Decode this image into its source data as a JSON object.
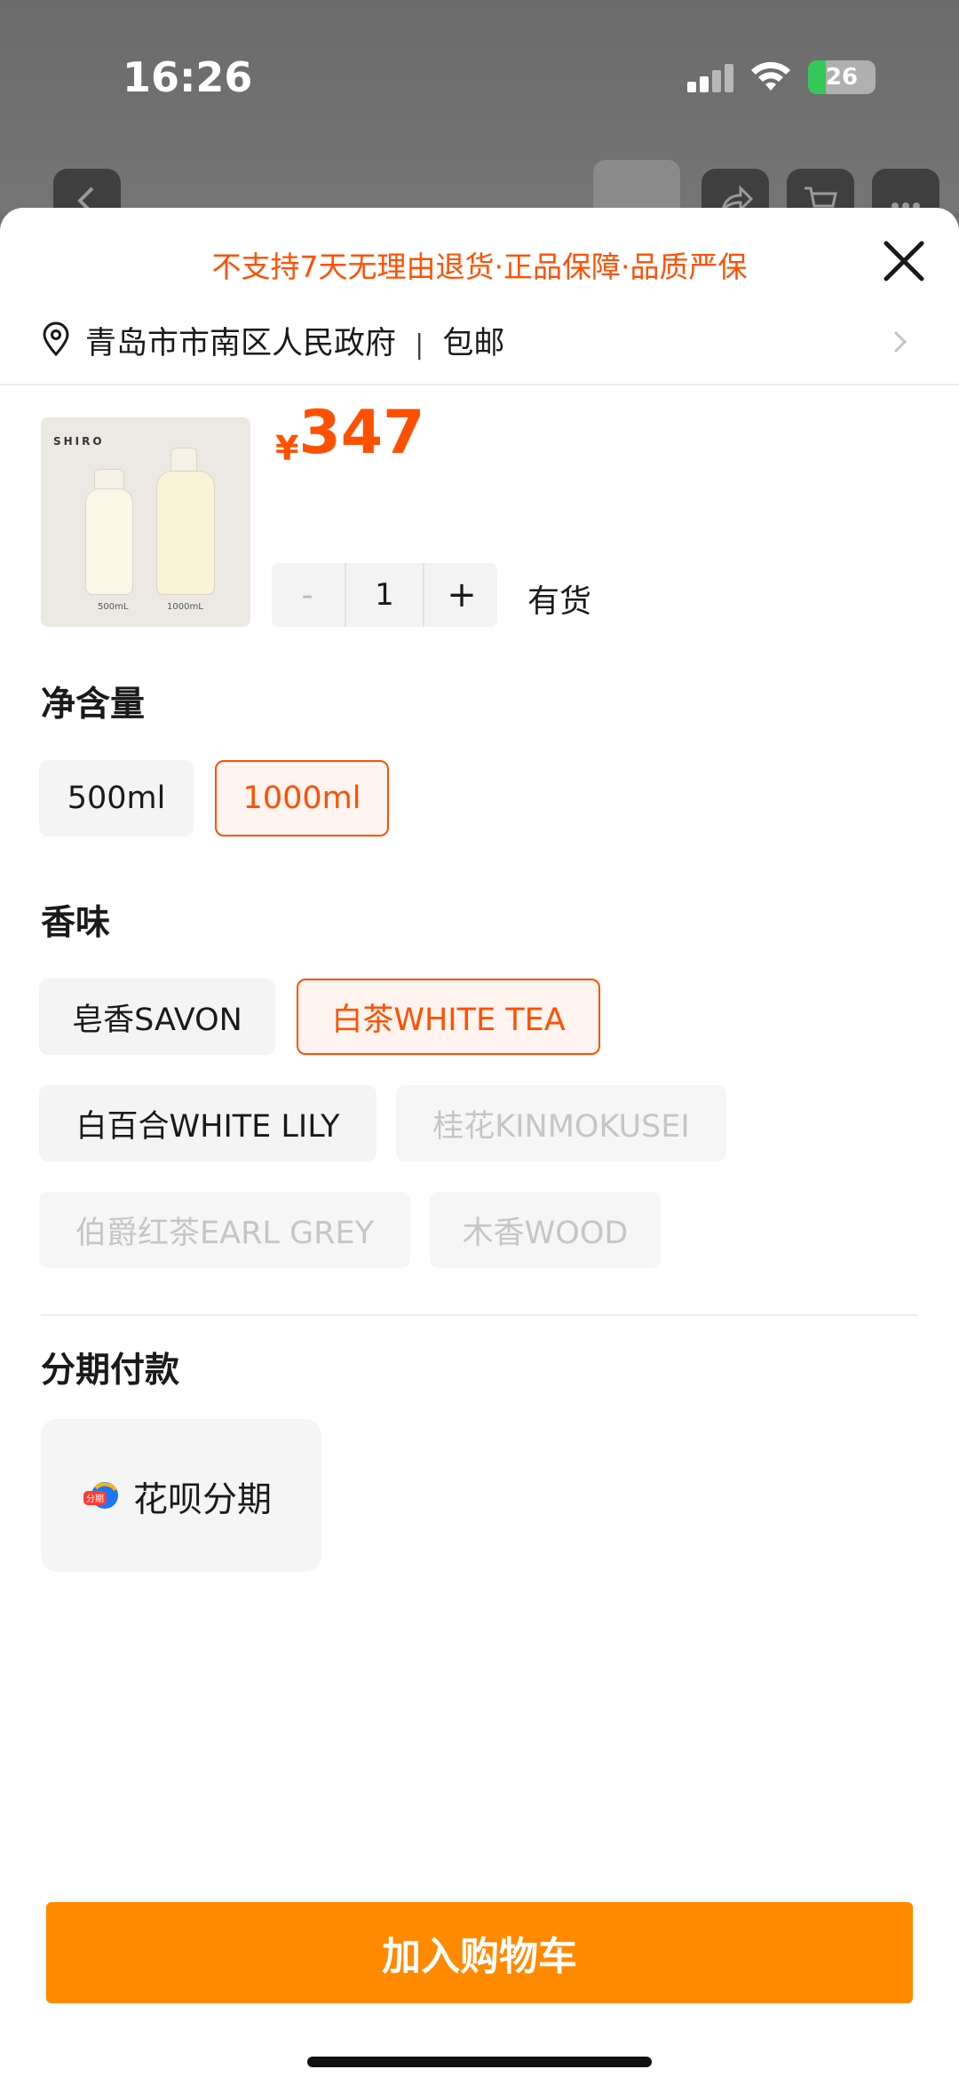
{
  "status_bar": {
    "time": "16:26",
    "battery": "26",
    "battery_level": 0.26
  },
  "notice": "不支持7天无理由退货·正品保障·品质严保",
  "address": {
    "location": "青岛市市南区人民政府",
    "separator": "|",
    "shipping": "包邮"
  },
  "product": {
    "brand_logo": "SHIRO",
    "image_captions": [
      "500mL",
      "1000mL"
    ],
    "currency": "¥",
    "price": "347",
    "quantity": "1",
    "minus_label": "-",
    "plus_label": "+",
    "stock_status": "有货"
  },
  "volume": {
    "title": "净含量",
    "options": [
      {
        "label": "500ml",
        "state": "normal"
      },
      {
        "label": "1000ml",
        "state": "selected"
      }
    ]
  },
  "scent": {
    "title": "香味",
    "options": [
      {
        "label": "皂香SAVON",
        "state": "normal"
      },
      {
        "label": "白茶WHITE TEA",
        "state": "selected"
      },
      {
        "label": "白百合WHITE LILY",
        "state": "normal"
      },
      {
        "label": "桂花KINMOKUSEI",
        "state": "disabled"
      },
      {
        "label": "伯爵红茶EARL GREY",
        "state": "disabled"
      },
      {
        "label": "木香WOOD",
        "state": "disabled"
      }
    ]
  },
  "installment": {
    "title": "分期付款",
    "badge_text": "分期",
    "option_label": "花呗分期"
  },
  "actions": {
    "add_to_cart": "加入购物车"
  },
  "colors": {
    "accent": "#ff5000",
    "cta": "#ff8a00",
    "chip_bg": "#f4f4f4"
  },
  "icons": [
    "back-arrow-icon",
    "share-icon",
    "cart-icon",
    "more-icon",
    "location-pin-icon",
    "close-icon",
    "chevron-right-icon",
    "huabei-icon"
  ]
}
